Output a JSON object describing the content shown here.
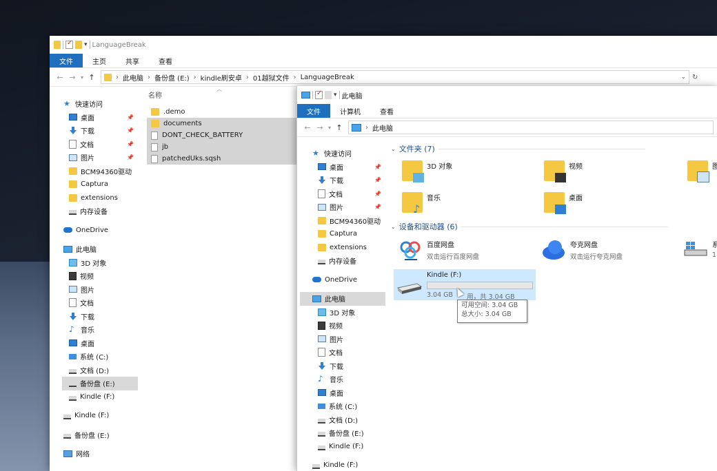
{
  "window1": {
    "title": "LanguageBreak",
    "tabs": [
      "文件",
      "主页",
      "共享",
      "查看"
    ],
    "address": [
      "此电脑",
      "备份盘 (E:)",
      "kindle刷安卓",
      "01越狱文件",
      "LanguageBreak"
    ],
    "column_name": "名称",
    "sidebar": [
      {
        "label": "快速访问",
        "icon": "star-icon"
      },
      {
        "label": "桌面",
        "icon": "desktop-icon",
        "pin": true
      },
      {
        "label": "下载",
        "icon": "download-icon",
        "pin": true
      },
      {
        "label": "文档",
        "icon": "document-icon",
        "pin": true
      },
      {
        "label": "图片",
        "icon": "pictures-icon",
        "pin": true
      },
      {
        "label": "BCM94360驱动",
        "icon": "folder-icon"
      },
      {
        "label": "Captura",
        "icon": "folder-icon"
      },
      {
        "label": "extensions",
        "icon": "folder-icon"
      },
      {
        "label": "内存设备",
        "icon": "drive-icon"
      },
      {
        "label": "OneDrive",
        "icon": "onedrive-icon"
      },
      {
        "label": "此电脑",
        "icon": "pc-icon"
      },
      {
        "label": "3D 对象",
        "icon": "3d-objects-icon"
      },
      {
        "label": "视频",
        "icon": "video-icon"
      },
      {
        "label": "图片",
        "icon": "pictures-icon"
      },
      {
        "label": "文档",
        "icon": "document-icon"
      },
      {
        "label": "下载",
        "icon": "download-icon"
      },
      {
        "label": "音乐",
        "icon": "music-icon"
      },
      {
        "label": "桌面",
        "icon": "desktop-icon"
      },
      {
        "label": "系统 (C:)",
        "icon": "windows-drive-icon"
      },
      {
        "label": "文档 (D:)",
        "icon": "drive-icon"
      },
      {
        "label": "备份盘 (E:)",
        "icon": "drive-icon",
        "selected": true
      },
      {
        "label": "Kindle (F:)",
        "icon": "drive-icon"
      },
      {
        "label": "Kindle (F:)",
        "icon": "drive-icon"
      },
      {
        "label": "备份盘 (E:)",
        "icon": "drive-icon"
      },
      {
        "label": "网络",
        "icon": "network-icon"
      }
    ],
    "files": [
      {
        "name": ".demo",
        "type": "folder",
        "selected": false
      },
      {
        "name": "documents",
        "type": "folder",
        "selected": true
      },
      {
        "name": "DONT_CHECK_BATTERY",
        "type": "file",
        "selected": true
      },
      {
        "name": "jb",
        "type": "file",
        "selected": true
      },
      {
        "name": "patchedUks.sqsh",
        "type": "file",
        "selected": true
      }
    ]
  },
  "window2": {
    "title": "此电脑",
    "tabs": [
      "文件",
      "计算机",
      "查看"
    ],
    "address": [
      "此电脑"
    ],
    "sidebar": [
      {
        "label": "快速访问",
        "icon": "star-icon"
      },
      {
        "label": "桌面",
        "icon": "desktop-icon",
        "pin": true
      },
      {
        "label": "下载",
        "icon": "download-icon",
        "pin": true
      },
      {
        "label": "文档",
        "icon": "document-icon",
        "pin": true
      },
      {
        "label": "图片",
        "icon": "pictures-icon",
        "pin": true
      },
      {
        "label": "BCM94360驱动",
        "icon": "folder-icon"
      },
      {
        "label": "Captura",
        "icon": "folder-icon"
      },
      {
        "label": "extensions",
        "icon": "folder-icon"
      },
      {
        "label": "内存设备",
        "icon": "drive-icon"
      },
      {
        "label": "OneDrive",
        "icon": "onedrive-icon"
      },
      {
        "label": "此电脑",
        "icon": "pc-icon",
        "selected": true
      },
      {
        "label": "3D 对象",
        "icon": "3d-objects-icon"
      },
      {
        "label": "视频",
        "icon": "video-icon"
      },
      {
        "label": "图片",
        "icon": "pictures-icon"
      },
      {
        "label": "文档",
        "icon": "document-icon"
      },
      {
        "label": "下载",
        "icon": "download-icon"
      },
      {
        "label": "音乐",
        "icon": "music-icon"
      },
      {
        "label": "桌面",
        "icon": "desktop-icon"
      },
      {
        "label": "系统 (C:)",
        "icon": "windows-drive-icon"
      },
      {
        "label": "文档 (D:)",
        "icon": "drive-icon"
      },
      {
        "label": "备份盘 (E:)",
        "icon": "drive-icon"
      },
      {
        "label": "Kindle (F:)",
        "icon": "drive-icon"
      },
      {
        "label": "Kindle (F:)",
        "icon": "drive-icon"
      }
    ],
    "folders_header": "文件夹 (7)",
    "folders": [
      "3D 对象",
      "视频",
      "图",
      "音乐",
      "桌面"
    ],
    "devices_header": "设备和驱动器 (6)",
    "devices": [
      {
        "name": "百度网盘",
        "sub": "双击运行百度网盘"
      },
      {
        "name": "夸克网盘",
        "sub": "双击运行夸克网盘"
      },
      {
        "name": "系",
        "sub": "1"
      },
      {
        "name": "Kindle (F:)",
        "sub": "3.04 GB 可用，共 3.04 GB",
        "sub_left": "3.04 GB",
        "sub_right": "用，共 3.04 GB",
        "used_fraction": 0.0
      }
    ],
    "tooltip": {
      "line1": "可用空间: 3.04 GB",
      "line2": "总大小: 3.04 GB"
    }
  },
  "colors": {
    "accent": "#1e6fbd",
    "folder": "#f5c842",
    "selected": "#cde8ff"
  }
}
